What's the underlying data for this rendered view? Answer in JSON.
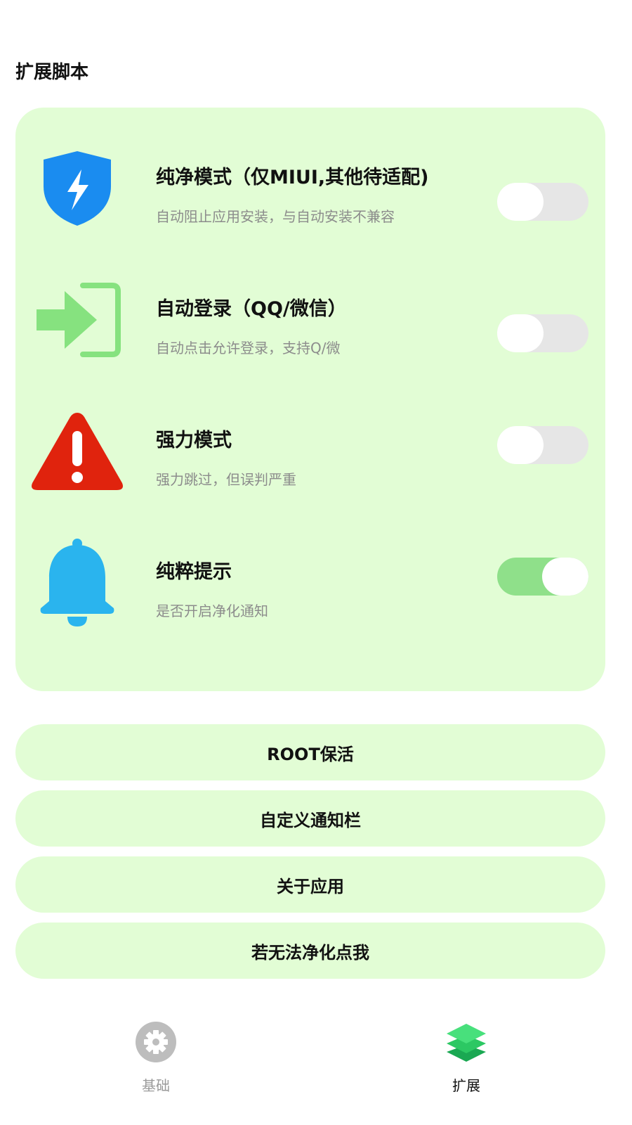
{
  "section": {
    "title": "扩展脚本"
  },
  "settings": [
    {
      "icon": "shield-lightning-icon",
      "title": "纯净模式（仅MIUI,其他待适配)",
      "subtitle": "自动阻止应用安装，与自动安装不兼容",
      "enabled": false
    },
    {
      "icon": "login-arrow-icon",
      "title": "自动登录（QQ/微信）",
      "subtitle": "自动点击允许登录，支持Q/微",
      "enabled": false
    },
    {
      "icon": "warning-triangle-icon",
      "title": "强力模式",
      "subtitle": "强力跳过，但误判严重",
      "enabled": false
    },
    {
      "icon": "bell-icon",
      "title": "纯粹提示",
      "subtitle": "是否开启净化通知",
      "enabled": true
    }
  ],
  "buttons": [
    {
      "label": "ROOT保活"
    },
    {
      "label": "自定义通知栏"
    },
    {
      "label": "关于应用"
    },
    {
      "label": "若无法净化点我"
    }
  ],
  "nav": {
    "items": [
      {
        "icon": "gear-icon",
        "label": "基础",
        "active": false
      },
      {
        "icon": "layers-icon",
        "label": "扩展",
        "active": true
      }
    ]
  },
  "colors": {
    "card_bg": "#e2fdd5",
    "toggle_on": "#8fe08a",
    "toggle_off": "#e6e6e6",
    "shield": "#1a8cf0",
    "login": "#86e27f",
    "warning": "#e0230d",
    "bell": "#2ab4ee"
  }
}
